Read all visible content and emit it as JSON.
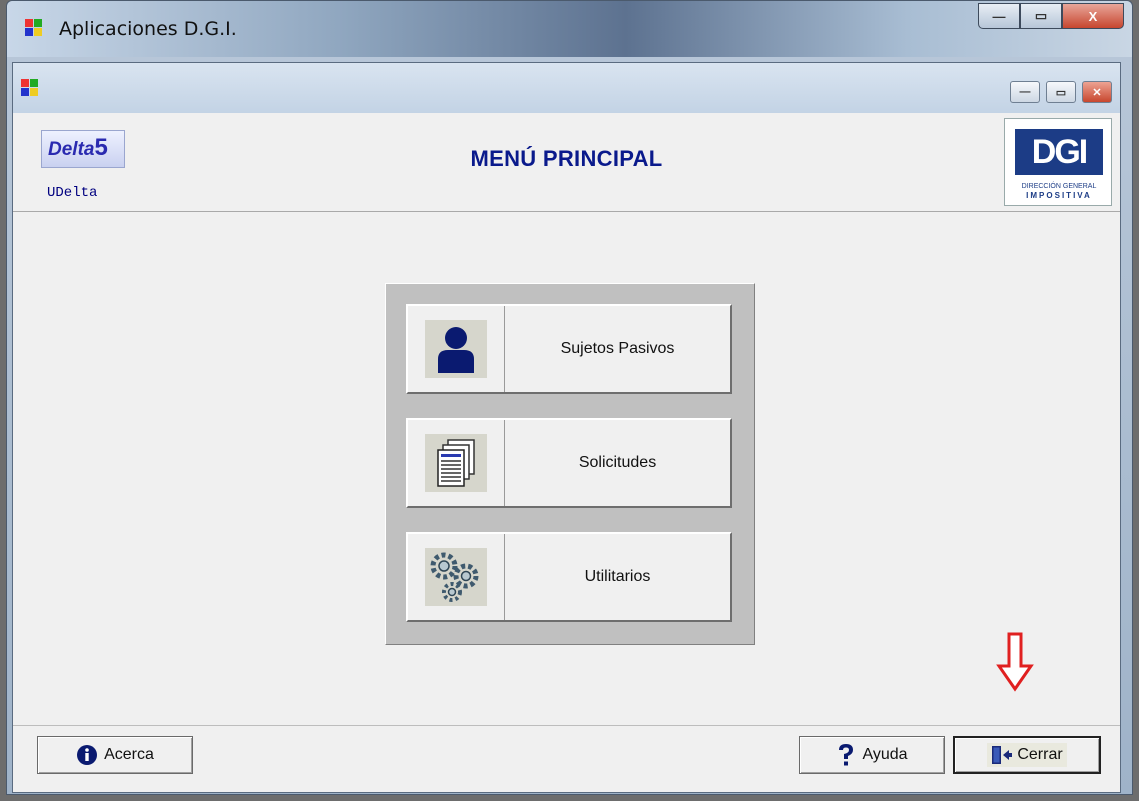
{
  "outer_window": {
    "title": "Aplicaciones  D.G.I.",
    "controls": {
      "minimize": "—",
      "maximize": "▭",
      "close": "X"
    }
  },
  "inner_window": {
    "controls": {
      "minimize": "—",
      "maximize": "▭",
      "close": "✕"
    }
  },
  "header": {
    "logo_text": "Delta",
    "logo_number": "5",
    "app_name": "UDelta",
    "title": "MENÚ PRINCIPAL",
    "dgi_logo_text": "DGI",
    "dgi_caption_1": "DIRECCIÓN GENERAL",
    "dgi_caption_2": "IMPOSITIVA"
  },
  "menu": {
    "items": [
      {
        "label": "Sujetos Pasivos",
        "icon": "person-icon"
      },
      {
        "label": "Solicitudes",
        "icon": "documents-icon"
      },
      {
        "label": "Utilitarios",
        "icon": "gears-icon"
      }
    ]
  },
  "footer": {
    "about_label": "Acerca",
    "help_label": "Ayuda",
    "close_label": "Cerrar"
  },
  "colors": {
    "title_blue": "#0a1a8c",
    "annotation_arrow": "#e02020",
    "dgi_blue": "#1c3c86",
    "dgi_yellow": "#f4c61a"
  }
}
